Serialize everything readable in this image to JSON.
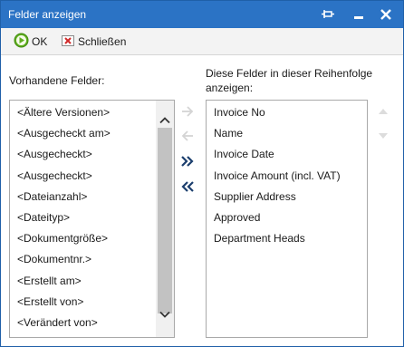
{
  "window": {
    "title": "Felder anzeigen"
  },
  "toolbar": {
    "ok_label": "OK",
    "close_label": "Schließen"
  },
  "left": {
    "label": "Vorhandene Felder:",
    "items": [
      "<Ältere Versionen>",
      "<Ausgecheckt am>",
      "<Ausgecheckt>",
      "<Ausgecheckt>",
      "<Dateianzahl>",
      "<Dateityp>",
      "<Dokumentgröße>",
      "<Dokumentnr.>",
      "<Erstellt am>",
      "<Erstellt von>",
      "<Verändert von>"
    ]
  },
  "right": {
    "label": "Diese Felder in dieser Reihenfolge anzeigen:",
    "items": [
      "Invoice No",
      "Name",
      "Invoice Date",
      "Invoice Amount (incl. VAT)",
      "Supplier Address",
      "Approved",
      "Department Heads"
    ]
  },
  "colors": {
    "titlebar": "#2b73c5",
    "ok_green": "#5fae1e",
    "close_red": "#d02a2a"
  }
}
